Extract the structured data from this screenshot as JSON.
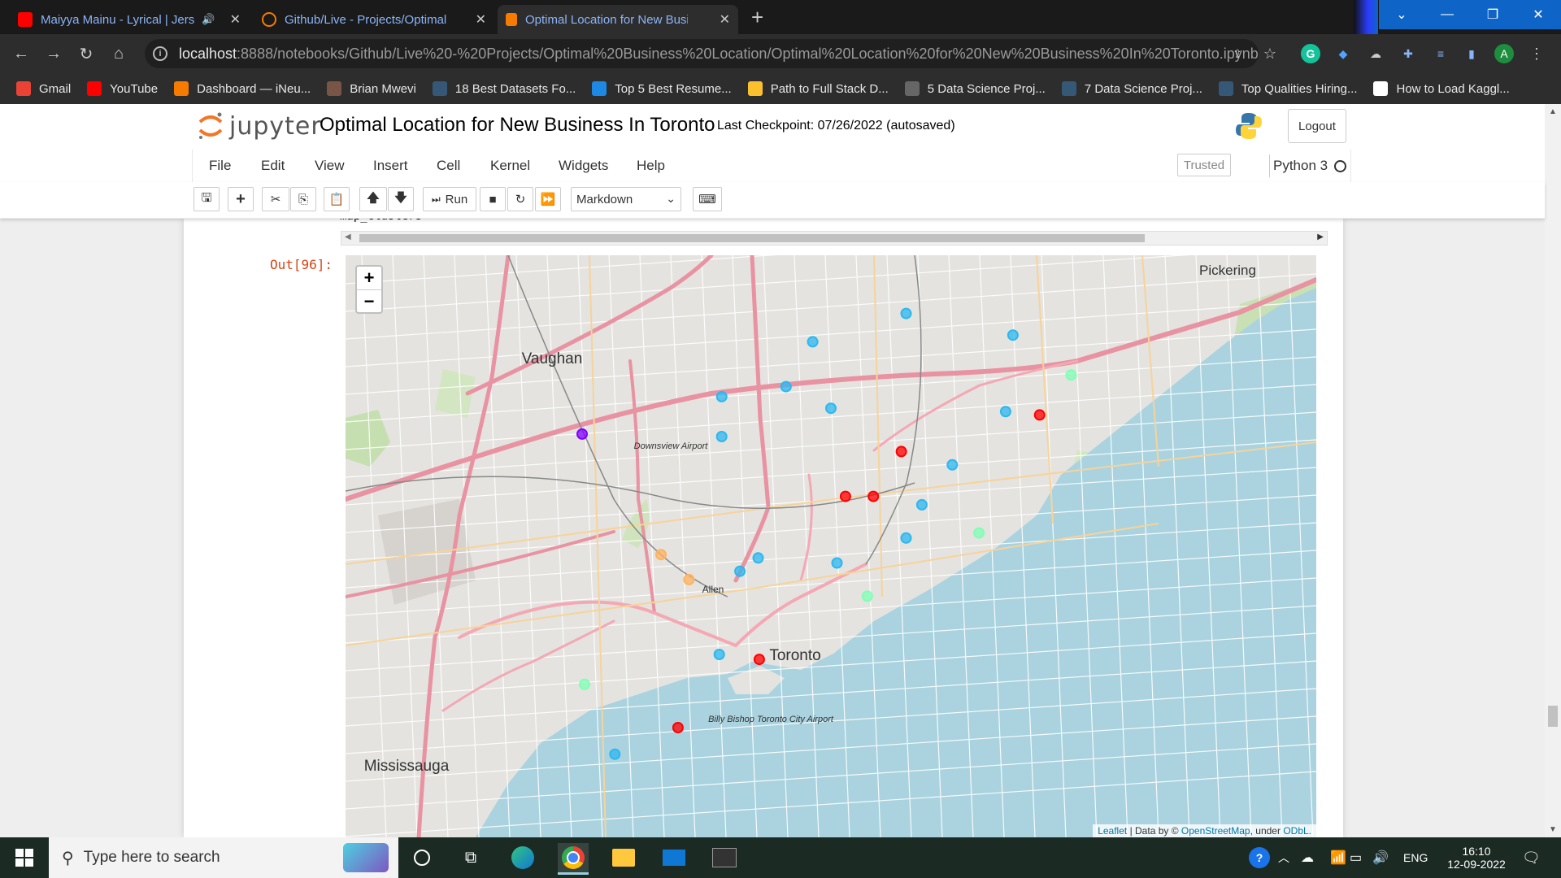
{
  "browser": {
    "tabs": [
      {
        "title": "Maiyya Mainu - Lyrical | Jersey",
        "state": "inactive"
      },
      {
        "title": "Github/Live - Projects/Optimal Business",
        "state": "inactive"
      },
      {
        "title": "Optimal Location for New Business",
        "state": "active"
      }
    ],
    "url_host": "localhost",
    "url_rest": ":8888/notebooks/Github/Live%20-%20Projects/Optimal%20Business%20Location/Optimal%20Location%20for%20New%20Business%20In%20Toronto.ipynb",
    "profile_letter": "A",
    "bookmarks": [
      {
        "label": "Gmail",
        "icon": "gmail-icon",
        "color": "#ea4335"
      },
      {
        "label": "YouTube",
        "icon": "youtube-icon",
        "color": "#ff0000"
      },
      {
        "label": "Dashboard — iNeu...",
        "icon": "ineuron-icon",
        "color": "#f57c00"
      },
      {
        "label": "Brian Mwevi",
        "icon": "person-icon",
        "color": "#795548"
      },
      {
        "label": "18 Best Datasets Fo...",
        "icon": "tds-icon",
        "color": "#355876"
      },
      {
        "label": "Top 5 Best Resume...",
        "icon": "t-icon",
        "color": "#1e88e5"
      },
      {
        "label": "Path to Full Stack D...",
        "icon": "k-icon",
        "color": "#fbc02d"
      },
      {
        "label": "5 Data Science Proj...",
        "icon": "globe-icon",
        "color": "#666666"
      },
      {
        "label": "7 Data Science Proj...",
        "icon": "tds-icon",
        "color": "#355876"
      },
      {
        "label": "Top Qualities Hiring...",
        "icon": "tds-icon",
        "color": "#355876"
      },
      {
        "label": "How to Load Kaggl...",
        "icon": "check-icon",
        "color": "#ffffff"
      }
    ]
  },
  "jupyter": {
    "logo_text": "jupyter",
    "notebook_title": "Optimal Location for New Business In Toronto",
    "checkpoint": "Last Checkpoint: 07/26/2022  (autosaved)",
    "logout_label": "Logout",
    "menu": [
      "File",
      "Edit",
      "View",
      "Insert",
      "Cell",
      "Kernel",
      "Widgets",
      "Help"
    ],
    "trusted_label": "Trusted",
    "kernel_label": "Python 3",
    "run_label": "Run",
    "cell_type": "Markdown",
    "code_tail": "map_clusters",
    "out_prompt": "Out[96]:"
  },
  "map": {
    "zoom_in": "+",
    "zoom_out": "−",
    "attribution_leaflet": "Leaflet",
    "attribution_mid": " | Data by © ",
    "attribution_osm": "OpenStreetMap",
    "attribution_under": ", under ",
    "attribution_odbl": "ODbL.",
    "place_labels": [
      "Vaughan",
      "Toronto",
      "Mississauga",
      "Pickering",
      "Downsview Airport",
      "Billy Bishop Toronto City Airport",
      "Allen"
    ],
    "cluster_colors": {
      "red": "#ff0000",
      "purple": "#8000ff",
      "blue": "#2db7f0",
      "green": "#80ffb4",
      "orange": "#ffb360"
    },
    "markers": [
      {
        "cluster": "purple",
        "lat": 43.7925,
        "lng": -79.605
      },
      {
        "cluster": "blue",
        "lat": 43.815,
        "lng": -79.49
      },
      {
        "cluster": "blue",
        "lat": 43.791,
        "lng": -79.49
      },
      {
        "cluster": "blue",
        "lat": 43.821,
        "lng": -79.437
      },
      {
        "cluster": "blue",
        "lat": 43.848,
        "lng": -79.415
      },
      {
        "cluster": "blue",
        "lat": 43.808,
        "lng": -79.4
      },
      {
        "cluster": "blue",
        "lat": 43.865,
        "lng": -79.338
      },
      {
        "cluster": "blue",
        "lat": 43.852,
        "lng": -79.25
      },
      {
        "cluster": "blue",
        "lat": 43.806,
        "lng": -79.256
      },
      {
        "cluster": "blue",
        "lat": 43.774,
        "lng": -79.3
      },
      {
        "cluster": "blue",
        "lat": 43.75,
        "lng": -79.325
      },
      {
        "cluster": "blue",
        "lat": 43.73,
        "lng": -79.338
      },
      {
        "cluster": "blue",
        "lat": 43.715,
        "lng": -79.395
      },
      {
        "cluster": "blue",
        "lat": 43.718,
        "lng": -79.46
      },
      {
        "cluster": "blue",
        "lat": 43.71,
        "lng": -79.475
      },
      {
        "cluster": "blue",
        "lat": 43.66,
        "lng": -79.492
      },
      {
        "cluster": "blue",
        "lat": 43.6,
        "lng": -79.578
      },
      {
        "cluster": "red",
        "lat": 43.782,
        "lng": -79.342
      },
      {
        "cluster": "red",
        "lat": 43.755,
        "lng": -79.388
      },
      {
        "cluster": "red",
        "lat": 43.755,
        "lng": -79.365
      },
      {
        "cluster": "red",
        "lat": 43.804,
        "lng": -79.228
      },
      {
        "cluster": "red",
        "lat": 43.657,
        "lng": -79.459
      },
      {
        "cluster": "red",
        "lat": 43.616,
        "lng": -79.526
      },
      {
        "cluster": "green",
        "lat": 43.828,
        "lng": -79.202
      },
      {
        "cluster": "green",
        "lat": 43.733,
        "lng": -79.278
      },
      {
        "cluster": "green",
        "lat": 43.695,
        "lng": -79.37
      },
      {
        "cluster": "green",
        "lat": 43.642,
        "lng": -79.603
      },
      {
        "cluster": "orange",
        "lat": 43.72,
        "lng": -79.54
      },
      {
        "cluster": "orange",
        "lat": 43.705,
        "lng": -79.517
      }
    ]
  },
  "taskbar": {
    "search_placeholder": "Type here to search",
    "language": "ENG",
    "time": "16:10",
    "date": "12-09-2022"
  }
}
